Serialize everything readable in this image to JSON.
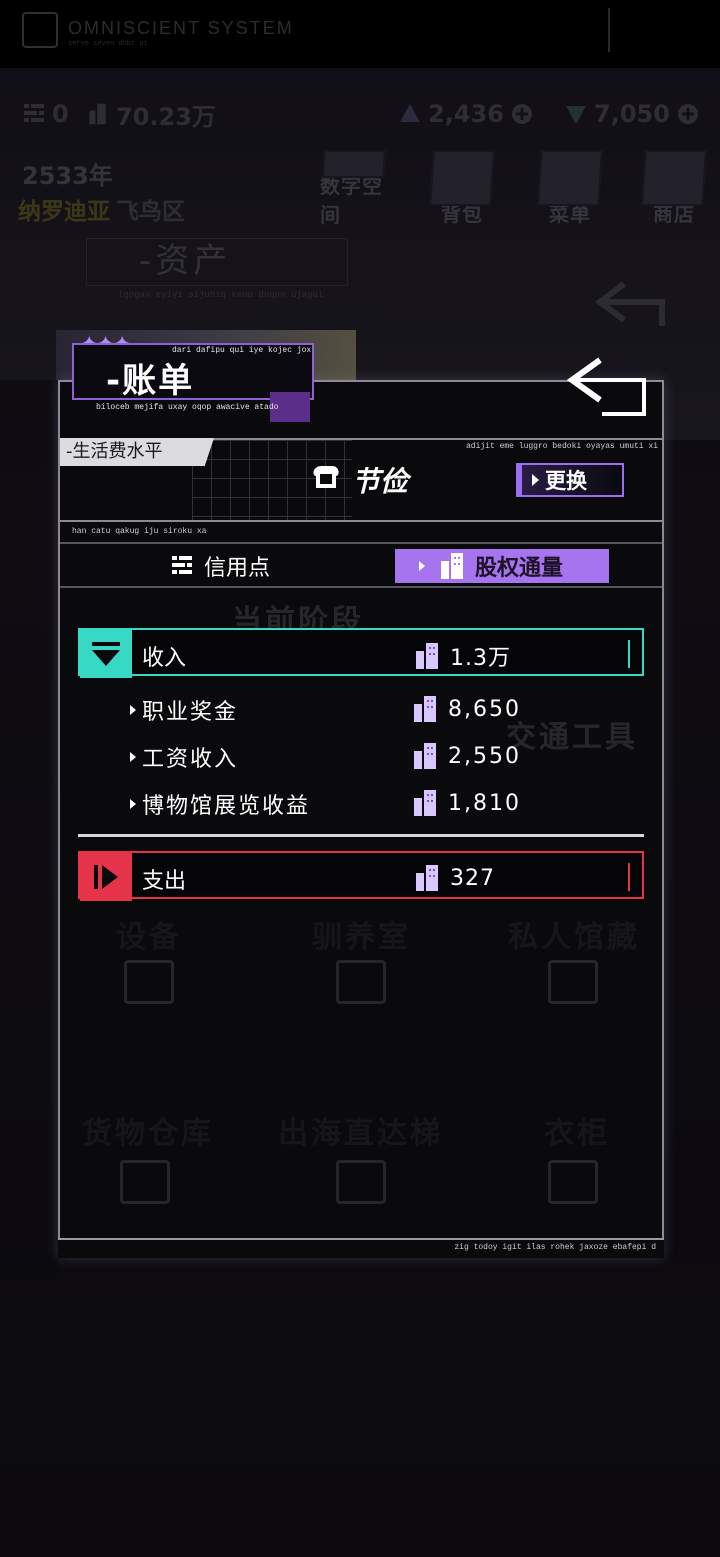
{
  "status_bar": {
    "system_title": "OMNISCIENT SYSTEM",
    "system_subtitle": "serve seven dobt ut"
  },
  "currency_bar": {
    "credit": "0",
    "equity": "70.23万",
    "gem_a": "2,436",
    "gem_b": "7,050"
  },
  "background": {
    "year": "2533年",
    "location_main": "纳罗迪亚",
    "location_sub": "飞鸟区",
    "menu": [
      "数字空间",
      "背包",
      "菜单",
      "商店"
    ],
    "asset_title": "-资产",
    "asset_sub": "lgogax eyiyi sijuhiq kenu duqun ujagul",
    "grid_labels": [
      "当前阶段",
      "交通工具",
      "设备",
      "驯养室",
      "私人馆藏",
      "货物仓库",
      "出海直达梯",
      "衣柜"
    ]
  },
  "panel": {
    "title": "-账单",
    "title_caption_top": "dari dafipu qui iye kojec jox",
    "title_caption_bottom": "biloceb mejifa uxay oqop awacive atado",
    "living_standard": {
      "label": "-生活费水平",
      "value": "节俭",
      "caption": "adijit eme luggro bedoki oyayas umuti xi",
      "change_button": "更换"
    },
    "section_caption": "han catu qakug iju siroku xa",
    "tabs": {
      "credit": "信用点",
      "equity": "股权通量"
    },
    "income": {
      "label": "收入",
      "value": "1.3万",
      "items": [
        {
          "label": "职业奖金",
          "value": "8,650"
        },
        {
          "label": "工资收入",
          "value": "2,550"
        },
        {
          "label": "博物馆展览收益",
          "value": "1,810"
        }
      ]
    },
    "expense": {
      "label": "支出",
      "value": "327"
    },
    "footer_caption": "zig todoy igit ilas rohek jaxoze ebafepi d"
  },
  "colors": {
    "accent_purple": "#a774f0",
    "income_teal": "#37d8c4",
    "expense_red": "#e5334a"
  }
}
